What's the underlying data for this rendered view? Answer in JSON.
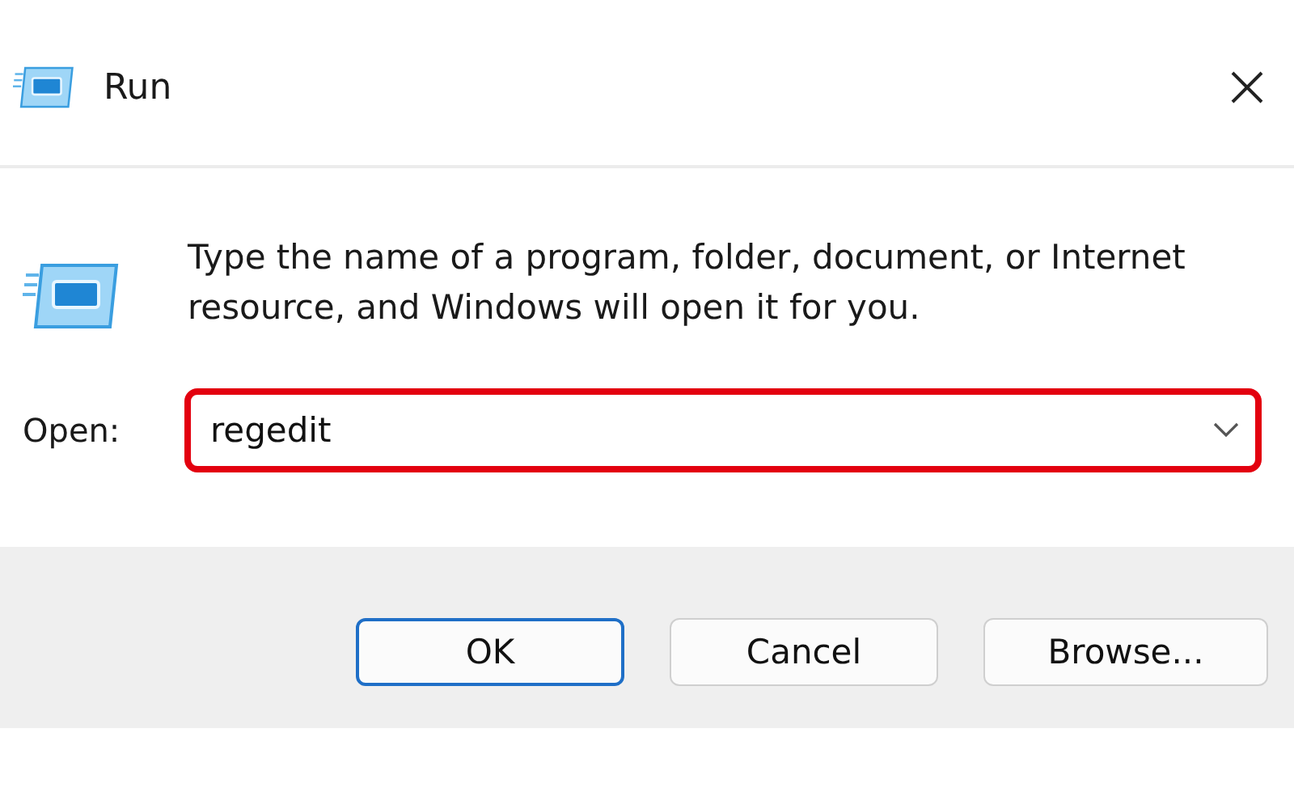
{
  "window": {
    "title": "Run"
  },
  "description": "Type the name of a program, folder, document, or Internet resource, and Windows will open it for you.",
  "open_field": {
    "label": "Open:",
    "value": "regedit",
    "highlighted": true
  },
  "buttons": [
    {
      "label": "OK",
      "default": true
    },
    {
      "label": "Cancel",
      "default": false
    },
    {
      "label": "Browse...",
      "default": false
    }
  ]
}
